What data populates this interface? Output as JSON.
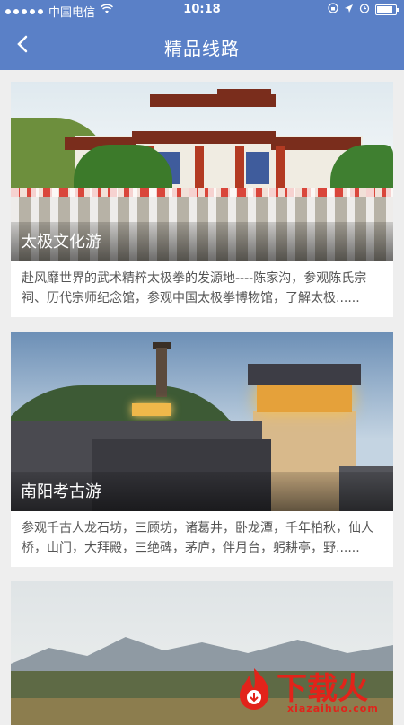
{
  "status_bar": {
    "carrier": "中国电信",
    "time": "10:18",
    "battery_level": 0.95
  },
  "nav": {
    "title": "精品线路",
    "back_icon": "chevron-left-icon"
  },
  "routes": [
    {
      "title": "太极文化游",
      "description": "赴风靡世界的武术精粹太极拳的发源地----陈家沟，参观陈氏宗祠、历代宗师纪念馆，参观中国太极拳博物馆，了解太极......"
    },
    {
      "title": "南阳考古游",
      "description": "参观千古人龙石坊，三顾坊，诸葛井，卧龙潭，千年柏秋，仙人桥，山门，大拜殿，三绝碑，茅庐，伴月台，躬耕亭，野......"
    },
    {
      "title": "",
      "description": ""
    }
  ],
  "watermark": {
    "text": "下载火",
    "url": "xiazaihuo.com"
  },
  "colors": {
    "brand_blue": "#5a80c7",
    "watermark_red": "#e2231a"
  }
}
